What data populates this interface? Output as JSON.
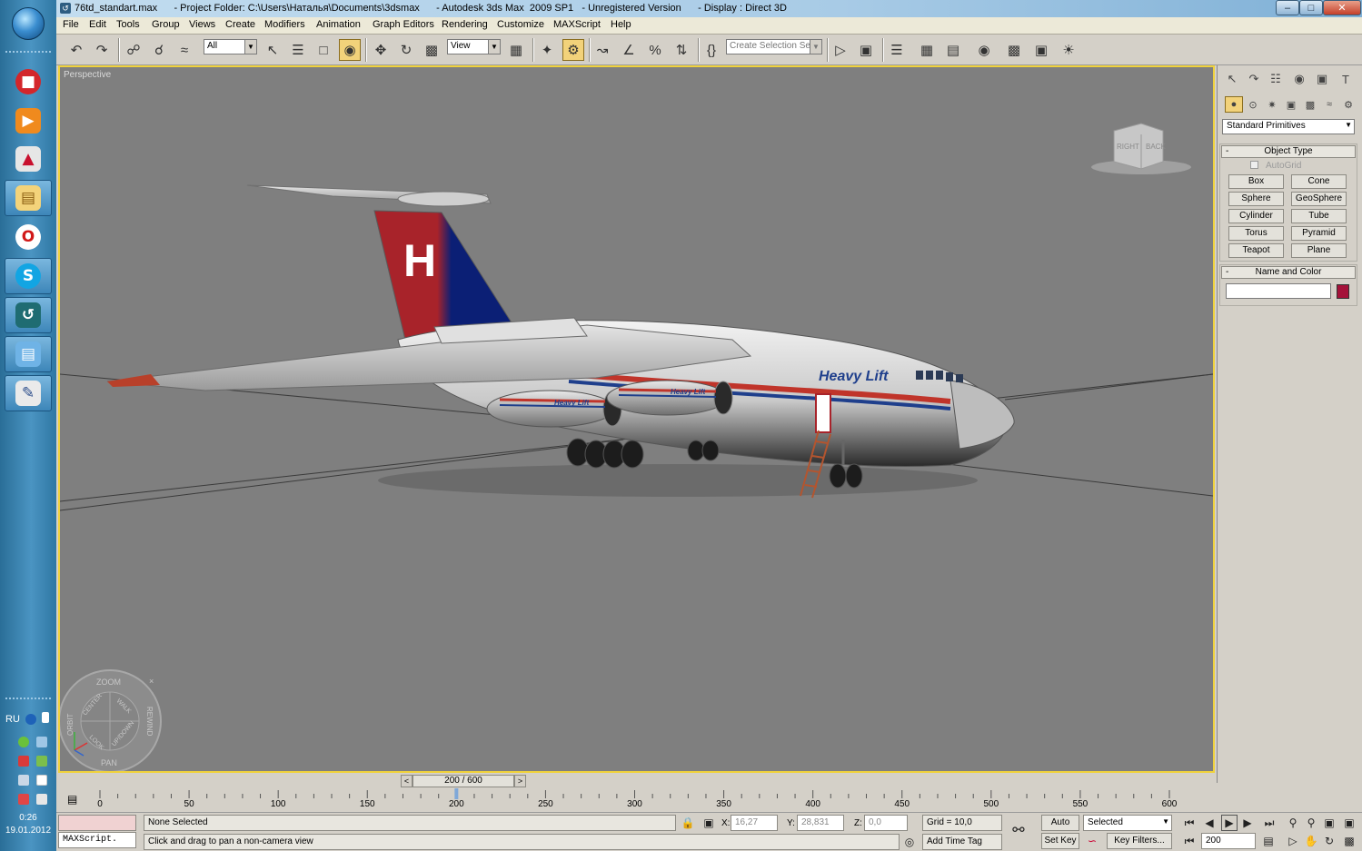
{
  "window": {
    "title": "76td_standart.max      - Project Folder: C:\\Users\\Наталья\\Documents\\3dsmax      - Autodesk 3ds Max  2009 SP1   - Unregistered Version      - Display : Direct 3D"
  },
  "menu": [
    "File",
    "Edit",
    "Tools",
    "Group",
    "Views",
    "Create",
    "Modifiers",
    "Animation",
    "Graph Editors",
    "Rendering",
    "Customize",
    "MAXScript",
    "Help"
  ],
  "toolbar": {
    "filter_value": "All",
    "refcoord_value": "View",
    "selection_set_placeholder": "Create Selection Se"
  },
  "viewport": {
    "label": "Perspective",
    "viewcube_labels": [
      "RIGHT",
      "BACK"
    ],
    "steering_wheel": {
      "zoom": "ZOOM",
      "orbit": "ORBIT",
      "rewind": "REWIND",
      "pan": "PAN",
      "center": "CENTER",
      "walk": "WALK",
      "look": "LOOK",
      "updown": "UP/DOWN"
    },
    "fuselage_text": "Heavy Lift",
    "nacelle_text": "Heavy Lift",
    "tail_letter": "H",
    "colors": {
      "background": "#7f7f7f",
      "border": "#f0d23c",
      "stripe_red": "#c0342a",
      "stripe_blue": "#1f3f8c",
      "tail_red": "#a8232a",
      "tail_blue": "#0b1f75"
    }
  },
  "command_panel": {
    "category": "Standard Primitives",
    "object_type_title": "Object Type",
    "autogrid": "AutoGrid",
    "primitives": [
      "Box",
      "Cone",
      "Sphere",
      "GeoSphere",
      "Cylinder",
      "Tube",
      "Torus",
      "Pyramid",
      "Teapot",
      "Plane"
    ],
    "name_color_title": "Name and Color",
    "object_color": "#a4123a"
  },
  "timeline": {
    "frame_display": "200 / 600",
    "ticks": [
      "0",
      "50",
      "100",
      "150",
      "200",
      "250",
      "300",
      "350",
      "400",
      "450",
      "500",
      "550",
      "600"
    ],
    "current_frame": 200,
    "total_frames": 600
  },
  "status": {
    "maxscript": "MAXScript.",
    "selection": "None Selected",
    "prompt": "Click and drag to pan a non-camera view",
    "x_label": "X:",
    "x_value": "16,27",
    "y_label": "Y:",
    "y_value": "28,831",
    "z_label": "Z:",
    "z_value": "0,0",
    "grid": "Grid = 10,0",
    "add_time_tag": "Add Time Tag",
    "auto_key": "Auto Key",
    "set_key": "Set Key",
    "key_mode": "Selected",
    "key_filters": "Key Filters...",
    "frame_field": "200"
  },
  "taskbar": {
    "language": "RU",
    "time": "0:26",
    "date": "19.01.2012",
    "apps": [
      "stop-icon",
      "media-player-icon",
      "acrobat-icon",
      "explorer-icon",
      "opera-icon",
      "skype-icon",
      "max-icon",
      "network-icon",
      "document-icon"
    ]
  }
}
